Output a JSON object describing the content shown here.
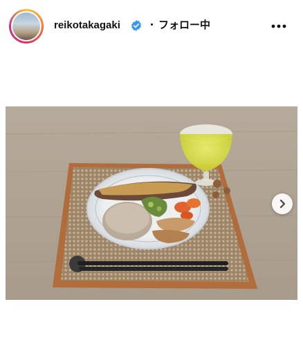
{
  "post": {
    "username": "reikotakagaki",
    "separator": "・",
    "follow_status": "フォロー中"
  },
  "icons": {
    "verified": "verified-badge-icon",
    "more": "more-options-icon",
    "next": "chevron-right-icon"
  },
  "colors": {
    "verified": "#3897f0",
    "text": "#111111"
  }
}
